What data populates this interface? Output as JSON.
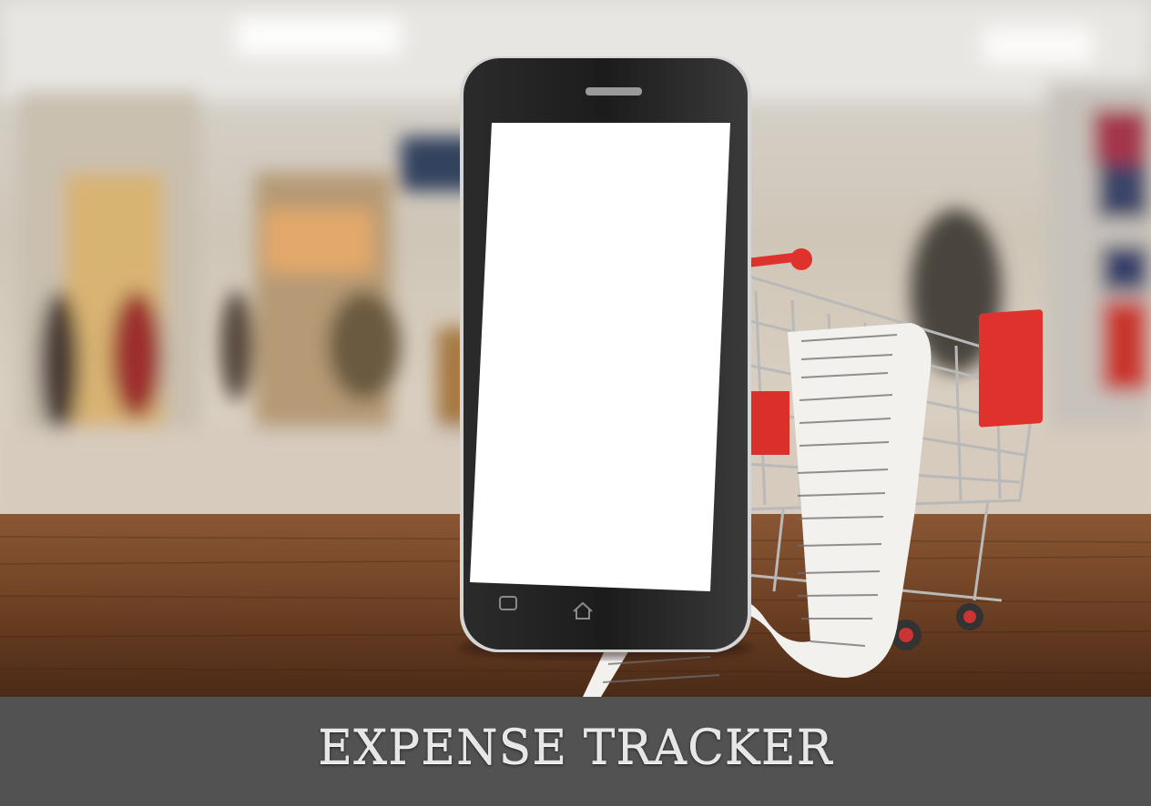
{
  "banner": {
    "title": "EXPENSE TRACKER"
  },
  "scene": {
    "description_icons": [
      "phone-icon",
      "receipt-icon",
      "shopping-cart-icon",
      "home-icon"
    ],
    "colors": {
      "cart_red": "#e0322c",
      "banner_bg": "#525252",
      "table_wood": "#7a4a2a"
    }
  }
}
